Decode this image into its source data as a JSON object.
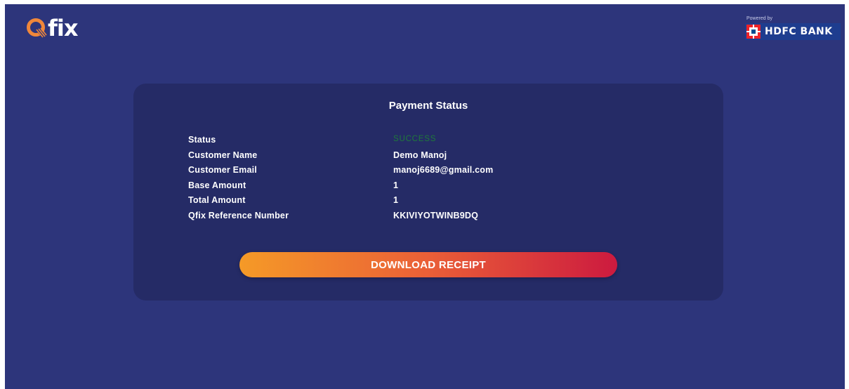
{
  "header": {
    "logo_text": "fix",
    "powered_by": "Powered by",
    "bank_name": "HDFC BANK"
  },
  "card": {
    "title": "Payment Status",
    "rows": [
      {
        "label": "Status",
        "value": "SUCCESS"
      },
      {
        "label": "Customer Name",
        "value": "Demo Manoj"
      },
      {
        "label": "Customer Email",
        "value": "manoj6689@gmail.com"
      },
      {
        "label": "Base Amount",
        "value": "1"
      },
      {
        "label": "Total Amount",
        "value": "1"
      },
      {
        "label": "Qfix Reference Number",
        "value": "KKIVIYOTWINB9DQ"
      }
    ],
    "button_label": "DOWNLOAD RECEIPT"
  },
  "colors": {
    "background": "#2d357b",
    "card": "#252b66",
    "success": "#1f7a3a",
    "button_start": "#f59a27",
    "button_end": "#cc1a3f",
    "logo_accent": "#f0873a"
  },
  "icons": [
    "qfix-logo-icon",
    "hdfc-logo-icon"
  ]
}
